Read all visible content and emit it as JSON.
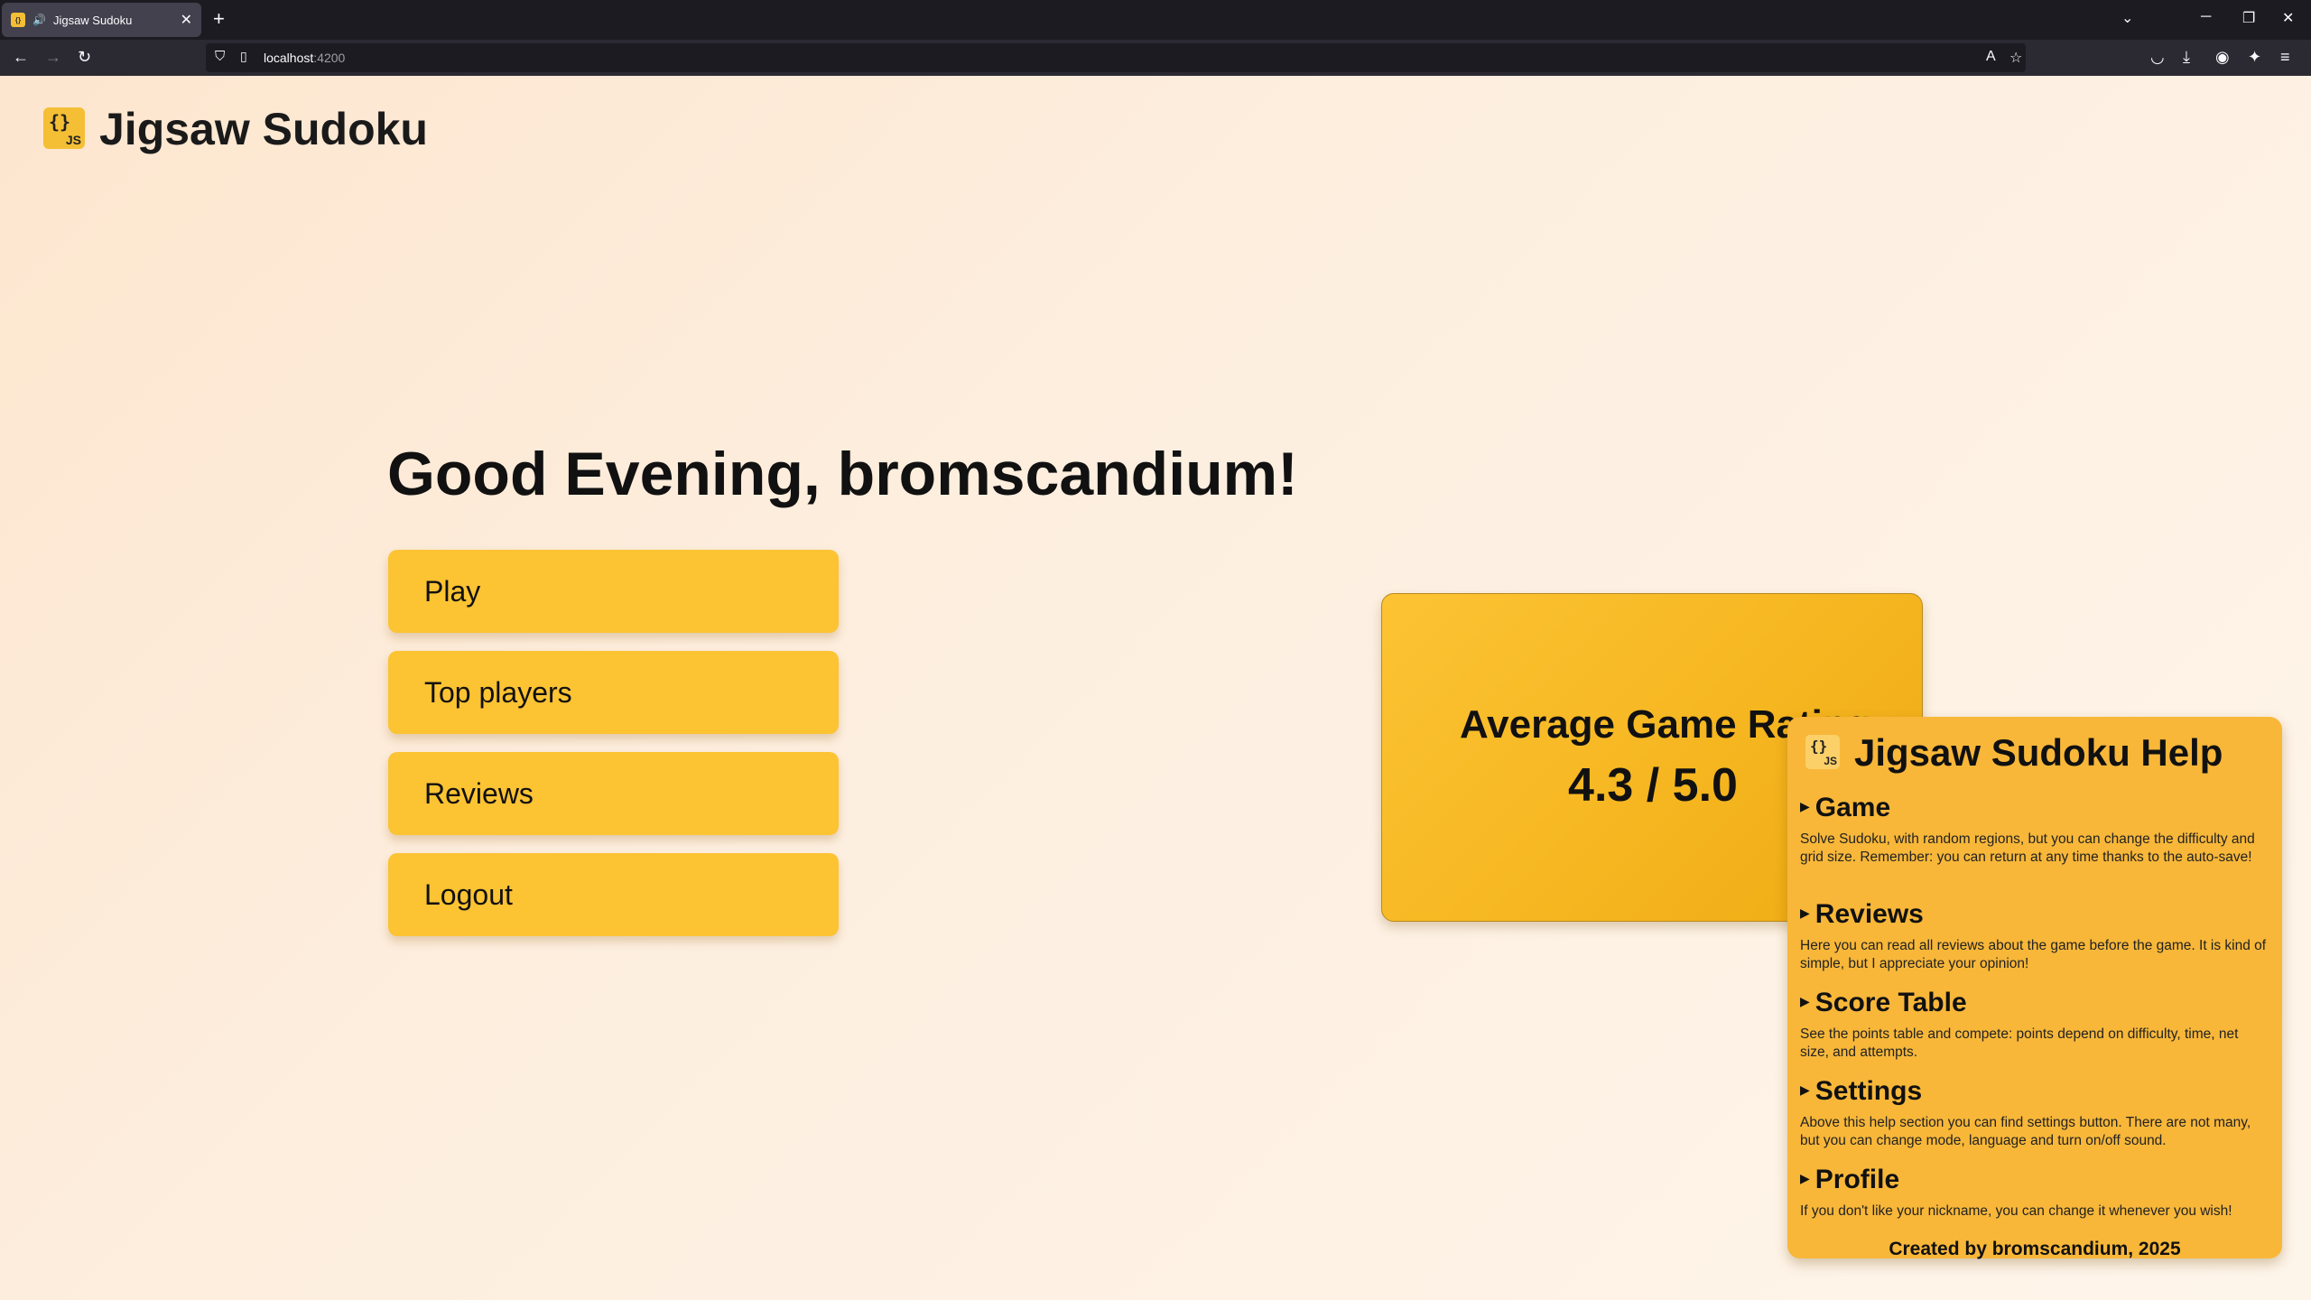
{
  "browser": {
    "tab_title": "Jigsaw Sudoku",
    "url_host": "localhost",
    "url_port": ":4200"
  },
  "header": {
    "title": "Jigsaw Sudoku",
    "logo_brackets": "{}",
    "logo_js": "JS"
  },
  "main": {
    "greeting": "Good Evening, bromscandium!",
    "menu": [
      {
        "label": "Play"
      },
      {
        "label": "Top players"
      },
      {
        "label": "Reviews"
      },
      {
        "label": "Logout"
      }
    ]
  },
  "rating": {
    "title": "Average Game Rating",
    "value": "4.3 / 5.0"
  },
  "help": {
    "title": "Jigsaw Sudoku Help",
    "sections": [
      {
        "title": "Game",
        "body": "Solve Sudoku, with random regions, but you can change the difficulty and grid size. Remember: you can return at any time thanks to the auto-save!"
      },
      {
        "title": "Reviews",
        "body": "Here you can read all reviews about the game before the game. It is kind of simple, but I appreciate your opinion!"
      },
      {
        "title": "Score Table",
        "body": "See the points table and compete: points depend on difficulty, time, net size, and attempts."
      },
      {
        "title": "Settings",
        "body": "Above this help section you can find settings button. There are not many, but you can change mode, language and turn on/off sound."
      },
      {
        "title": "Profile",
        "body": "If you don't like your nickname, you can change it whenever you wish!"
      }
    ],
    "footer": "Created by bromscandium, 2025"
  },
  "colors": {
    "accent": "#fcc333",
    "help_bg": "#f8b739",
    "page_bg_start": "#fde6cf",
    "page_bg_end": "#fef5ea"
  }
}
